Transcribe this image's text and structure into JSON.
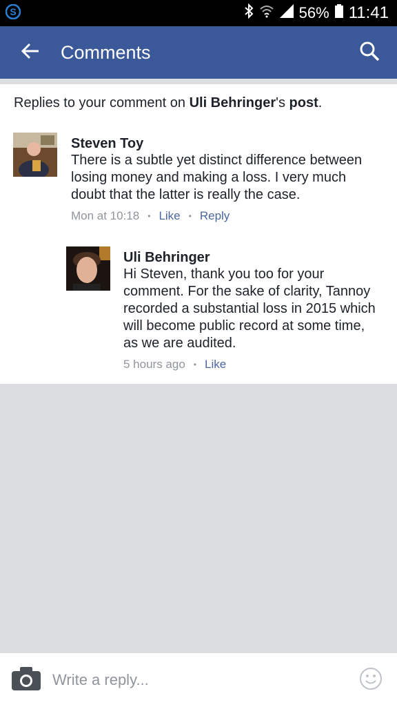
{
  "status_bar": {
    "app_icon": "skype-icon",
    "icons": [
      "bluetooth-icon",
      "wifi-icon",
      "signal-icon",
      "battery-icon"
    ],
    "battery": "56%",
    "time": "11:41"
  },
  "app_bar": {
    "title": "Comments",
    "back_icon": "back-arrow-icon",
    "search_icon": "search-icon",
    "color": "#3b5998"
  },
  "intro": {
    "prefix": "Replies to your comment on ",
    "author": "Uli Behringer",
    "possessive": "'s ",
    "post_link": "post",
    "suffix": "."
  },
  "comments": [
    {
      "author": "Steven Toy",
      "text": "There is a subtle yet distinct difference between losing money and making a loss. I very much doubt that the latter is really the case.",
      "time": "Mon at 10:18",
      "like": "Like",
      "reply": "Reply"
    },
    {
      "author": "Uli Behringer",
      "text": "Hi Steven, thank you too for your comment. For the sake of clarity, Tannoy recorded a substantial loss in 2015 which will become public record at some time, as we are audited.",
      "time": "5 hours ago",
      "like": "Like"
    }
  ],
  "composer": {
    "placeholder": "Write a reply...",
    "camera_icon": "camera-icon",
    "emoji_icon": "emoji-icon"
  }
}
